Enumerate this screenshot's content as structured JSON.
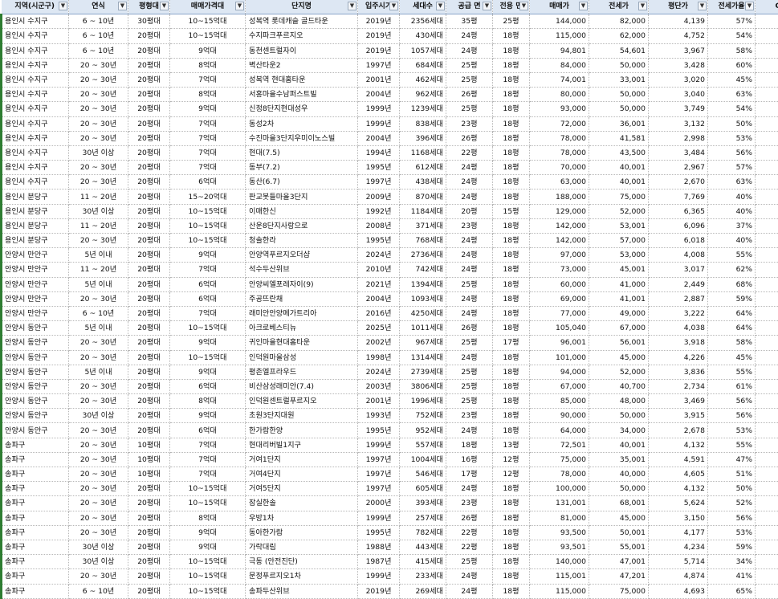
{
  "header": [
    {
      "label": "지역(시군구)",
      "filter": "▼",
      "sorted": true
    },
    {
      "label": "연식",
      "filter": "▼"
    },
    {
      "label": "평형대",
      "filter": "▼"
    },
    {
      "label": "매매가격대",
      "filter": "▼"
    },
    {
      "label": "단지명",
      "filter": "▼"
    },
    {
      "label": "입주시기",
      "filter": "▼"
    },
    {
      "label": "세대수",
      "filter": "▼"
    },
    {
      "label": "공급 면",
      "filter": "▼"
    },
    {
      "label": "전용 면",
      "filter": "▼"
    },
    {
      "label": "매매가",
      "filter": "▼",
      "sorted": true
    },
    {
      "label": "전세가",
      "filter": "▼"
    },
    {
      "label": "평단가",
      "filter": "▼"
    },
    {
      "label": "전세가율",
      "filter": "▼"
    },
    {
      "label": "Gap",
      "filter": "▼"
    }
  ],
  "rows": [
    [
      "용인시 수지구",
      "6 ~ 10년",
      "30평대",
      "10~15억대",
      "성복역 롯데캐슬 골드타운",
      "2019년",
      "2356세대",
      "35평",
      "25평",
      "144,000",
      "82,000",
      "4,139",
      "57%",
      "62,000"
    ],
    [
      "용인시 수지구",
      "6 ~ 10년",
      "20평대",
      "10~15억대",
      "수지파크푸르지오",
      "2019년",
      "430세대",
      "24평",
      "18평",
      "115,000",
      "62,000",
      "4,752",
      "54%",
      "53,000"
    ],
    [
      "용인시 수지구",
      "6 ~ 10년",
      "20평대",
      "9억대",
      "동천센트럴자이",
      "2019년",
      "1057세대",
      "24평",
      "18평",
      "94,801",
      "54,601",
      "3,967",
      "58%",
      "40,200"
    ],
    [
      "용인시 수지구",
      "20 ~ 30년",
      "20평대",
      "8억대",
      "벽산타운2",
      "1997년",
      "684세대",
      "25평",
      "18평",
      "84,000",
      "50,000",
      "3,428",
      "60%",
      "34,000"
    ],
    [
      "용인시 수지구",
      "20 ~ 30년",
      "20평대",
      "7억대",
      "성복역 현대홈타운",
      "2001년",
      "462세대",
      "25평",
      "18평",
      "74,001",
      "33,001",
      "3,020",
      "45%",
      "41,000"
    ],
    [
      "용인시 수지구",
      "20 ~ 30년",
      "20평대",
      "8억대",
      "서홍마을수남퍼스트빌",
      "2004년",
      "962세대",
      "26평",
      "18평",
      "80,000",
      "50,000",
      "3,040",
      "63%",
      "30,000"
    ],
    [
      "용인시 수지구",
      "20 ~ 30년",
      "20평대",
      "9억대",
      "신정8단지현대성우",
      "1999년",
      "1239세대",
      "25평",
      "18평",
      "93,000",
      "50,000",
      "3,749",
      "54%",
      "43,000"
    ],
    [
      "용인시 수지구",
      "20 ~ 30년",
      "20평대",
      "7억대",
      "동성2차",
      "1999년",
      "838세대",
      "23평",
      "18평",
      "72,000",
      "36,001",
      "3,132",
      "50%",
      "35,999"
    ],
    [
      "용인시 수지구",
      "20 ~ 30년",
      "20평대",
      "7억대",
      "수진마을3단지우미이노스빌",
      "2004년",
      "396세대",
      "26평",
      "18평",
      "78,000",
      "41,581",
      "2,998",
      "53%",
      "36,419"
    ],
    [
      "용인시 수지구",
      "30년 이상",
      "20평대",
      "7억대",
      "현대(7.5)",
      "1994년",
      "1168세대",
      "22평",
      "18평",
      "78,000",
      "43,500",
      "3,484",
      "56%",
      "34,500"
    ],
    [
      "용인시 수지구",
      "20 ~ 30년",
      "20평대",
      "7억대",
      "동부(7.2)",
      "1995년",
      "612세대",
      "24평",
      "18평",
      "70,000",
      "40,001",
      "2,967",
      "57%",
      "29,999"
    ],
    [
      "용인시 수지구",
      "20 ~ 30년",
      "20평대",
      "6억대",
      "동산(6.7)",
      "1997년",
      "438세대",
      "24평",
      "18평",
      "63,000",
      "40,001",
      "2,670",
      "63%",
      "22,999"
    ],
    [
      "용인시 분당구",
      "11 ~ 20년",
      "20평대",
      "15~20억대",
      "판교봇들마을3단지",
      "2009년",
      "870세대",
      "24평",
      "18평",
      "188,000",
      "75,000",
      "7,769",
      "40%",
      "113,000"
    ],
    [
      "용인시 분당구",
      "30년 이상",
      "20평대",
      "10~15억대",
      "이매한신",
      "1992년",
      "1184세대",
      "20평",
      "15평",
      "129,000",
      "52,000",
      "6,365",
      "40%",
      "77,000"
    ],
    [
      "용인시 분당구",
      "11 ~ 20년",
      "20평대",
      "10~15억대",
      "산운8단지사랑으로",
      "2008년",
      "371세대",
      "23평",
      "18평",
      "142,000",
      "53,001",
      "6,096",
      "37%",
      "88,999"
    ],
    [
      "용인시 분당구",
      "20 ~ 30년",
      "20평대",
      "10~15억대",
      "청솔한라",
      "1995년",
      "768세대",
      "24평",
      "18평",
      "142,000",
      "57,000",
      "6,018",
      "40%",
      "85,000"
    ],
    [
      "안양시 만안구",
      "5년 이내",
      "20평대",
      "9억대",
      "안양역푸르지오더샵",
      "2024년",
      "2736세대",
      "24평",
      "18평",
      "97,000",
      "53,000",
      "4,008",
      "55%",
      "44,000"
    ],
    [
      "안양시 만안구",
      "11 ~ 20년",
      "20평대",
      "7억대",
      "석수두산위브",
      "2010년",
      "742세대",
      "24평",
      "18평",
      "73,000",
      "45,001",
      "3,017",
      "62%",
      "27,999"
    ],
    [
      "안양시 만안구",
      "5년 이내",
      "20평대",
      "6억대",
      "안양씨엘포레자이(9)",
      "2021년",
      "1394세대",
      "25평",
      "18평",
      "60,000",
      "41,000",
      "2,449",
      "68%",
      "19,000"
    ],
    [
      "안양시 만안구",
      "20 ~ 30년",
      "20평대",
      "6억대",
      "주공뜨란채",
      "2004년",
      "1093세대",
      "24평",
      "18평",
      "69,000",
      "41,001",
      "2,887",
      "59%",
      "27,999"
    ],
    [
      "안양시 만안구",
      "6 ~ 10년",
      "20평대",
      "7억대",
      "래미안안양메가트리아",
      "2016년",
      "4250세대",
      "24평",
      "18평",
      "77,000",
      "49,000",
      "3,222",
      "64%",
      "28,000"
    ],
    [
      "안양시 동안구",
      "5년 이내",
      "20평대",
      "10~15억대",
      "아크로베스티뉴",
      "2025년",
      "1011세대",
      "26평",
      "18평",
      "105,040",
      "67,000",
      "4,038",
      "64%",
      "38,040"
    ],
    [
      "안양시 동안구",
      "20 ~ 30년",
      "20평대",
      "9억대",
      "귀인마을현대홈타운",
      "2002년",
      "967세대",
      "25평",
      "17평",
      "96,001",
      "56,001",
      "3,918",
      "58%",
      "40,000"
    ],
    [
      "안양시 동안구",
      "20 ~ 30년",
      "20평대",
      "10~15억대",
      "인덕원마을삼성",
      "1998년",
      "1314세대",
      "24평",
      "18평",
      "101,000",
      "45,000",
      "4,226",
      "45%",
      "56,000"
    ],
    [
      "안양시 동안구",
      "5년 이내",
      "20평대",
      "9억대",
      "평촌엘프라우드",
      "2024년",
      "2739세대",
      "25평",
      "18평",
      "94,000",
      "52,000",
      "3,836",
      "55%",
      "42,000"
    ],
    [
      "안양시 동안구",
      "20 ~ 30년",
      "20평대",
      "6억대",
      "비산삼성래미안(7.4)",
      "2003년",
      "3806세대",
      "25평",
      "18평",
      "67,000",
      "40,700",
      "2,734",
      "61%",
      "26,300"
    ],
    [
      "안양시 동안구",
      "20 ~ 30년",
      "20평대",
      "8억대",
      "인덕원센트럴푸르지오",
      "2001년",
      "1996세대",
      "25평",
      "18평",
      "85,000",
      "48,000",
      "3,469",
      "56%",
      "37,000"
    ],
    [
      "안양시 동안구",
      "30년 이상",
      "20평대",
      "9억대",
      "초원3단지대원",
      "1993년",
      "752세대",
      "23평",
      "18평",
      "90,000",
      "50,000",
      "3,915",
      "56%",
      "40,000"
    ],
    [
      "안양시 동안구",
      "20 ~ 30년",
      "20평대",
      "6억대",
      "한가람한양",
      "1995년",
      "952세대",
      "24평",
      "18평",
      "64,000",
      "34,000",
      "2,678",
      "53%",
      "30,000"
    ],
    [
      "송파구",
      "20 ~ 30년",
      "10평대",
      "7억대",
      "현대리버빌1지구",
      "1999년",
      "557세대",
      "18평",
      "13평",
      "72,501",
      "40,001",
      "4,132",
      "55%",
      "32,500"
    ],
    [
      "송파구",
      "20 ~ 30년",
      "10평대",
      "7억대",
      "거여1단지",
      "1997년",
      "1004세대",
      "16평",
      "12평",
      "75,000",
      "35,001",
      "4,591",
      "47%",
      "39,999"
    ],
    [
      "송파구",
      "20 ~ 30년",
      "10평대",
      "7억대",
      "거여4단지",
      "1997년",
      "546세대",
      "17평",
      "12평",
      "78,000",
      "40,000",
      "4,605",
      "51%",
      "38,000"
    ],
    [
      "송파구",
      "20 ~ 30년",
      "20평대",
      "10~15억대",
      "거여5단지",
      "1997년",
      "605세대",
      "24평",
      "18평",
      "100,000",
      "50,000",
      "4,132",
      "50%",
      "50,000"
    ],
    [
      "송파구",
      "20 ~ 30년",
      "20평대",
      "10~15억대",
      "잠실한솔",
      "2000년",
      "393세대",
      "23평",
      "18평",
      "131,001",
      "68,001",
      "5,624",
      "52%",
      "63,000"
    ],
    [
      "송파구",
      "20 ~ 30년",
      "20평대",
      "8억대",
      "우방1차",
      "1999년",
      "257세대",
      "26평",
      "18평",
      "81,000",
      "45,000",
      "3,150",
      "56%",
      "36,000"
    ],
    [
      "송파구",
      "20 ~ 30년",
      "20평대",
      "9억대",
      "동아한가람",
      "1995년",
      "782세대",
      "22평",
      "18평",
      "93,500",
      "50,001",
      "4,177",
      "53%",
      "43,500"
    ],
    [
      "송파구",
      "30년 이상",
      "20평대",
      "9억대",
      "가락대림",
      "1988년",
      "443세대",
      "22평",
      "18평",
      "93,501",
      "55,001",
      "4,234",
      "59%",
      "38,500"
    ],
    [
      "송파구",
      "30년 이상",
      "20평대",
      "10~15억대",
      "극동 (안전진단)",
      "1987년",
      "415세대",
      "25평",
      "18평",
      "140,000",
      "47,001",
      "5,714",
      "34%",
      "92,999"
    ],
    [
      "송파구",
      "20 ~ 30년",
      "20평대",
      "10~15억대",
      "문정푸르지오1차",
      "1999년",
      "233세대",
      "24평",
      "18평",
      "115,001",
      "47,201",
      "4,874",
      "41%",
      "67,800"
    ],
    [
      "송파구",
      "6 ~ 10년",
      "20평대",
      "10~15억대",
      "송파두산위브",
      "2019년",
      "269세대",
      "24평",
      "18평",
      "115,000",
      "75,000",
      "4,693",
      "65%",
      "40,000"
    ]
  ]
}
